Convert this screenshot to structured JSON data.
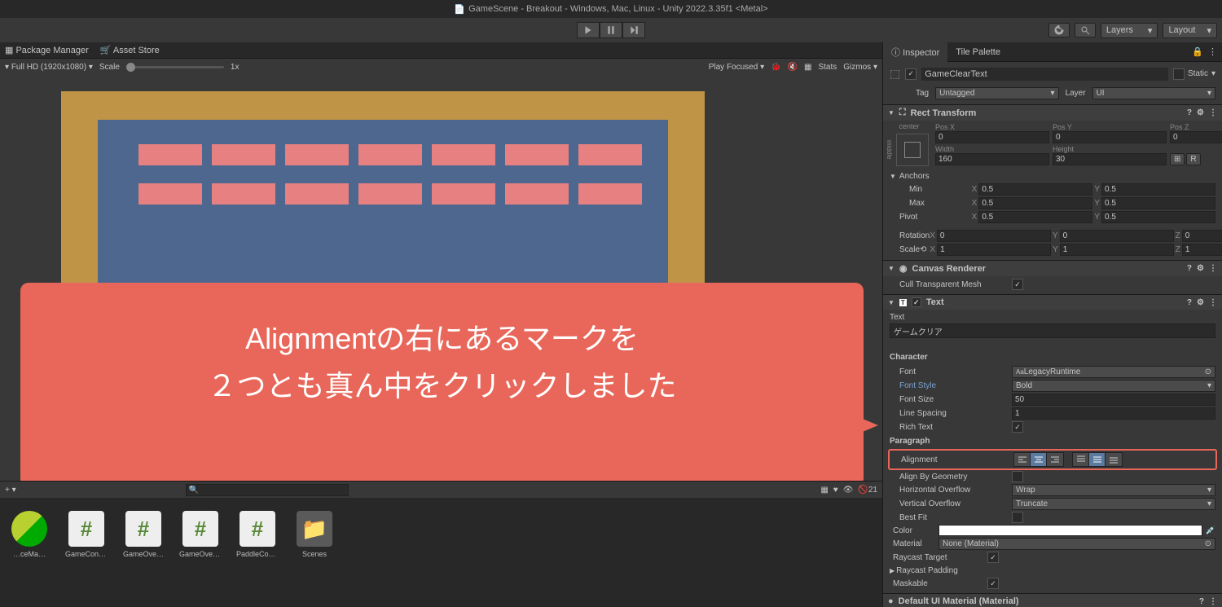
{
  "titlebar": "GameScene - Breakout - Windows, Mac, Linux - Unity 2022.3.35f1 <Metal>",
  "toolbar": {
    "layers": "Layers",
    "layout": "Layout"
  },
  "scene_tabs": {
    "package_manager": "Package Manager",
    "asset_store": "Asset Store"
  },
  "scene_controls": {
    "resolution": "Full HD (1920x1080)",
    "scale": "Scale",
    "scale_val": "1x",
    "play_focused": "Play Focused",
    "stats": "Stats",
    "gizmos": "Gizmos"
  },
  "project_bar": {
    "count": "21"
  },
  "assets": [
    {
      "label": "…ceMa…",
      "type": "ball"
    },
    {
      "label": "GameCont…",
      "type": "cs"
    },
    {
      "label": "GameOve…",
      "type": "cs"
    },
    {
      "label": "GameOver…",
      "type": "cs"
    },
    {
      "label": "PaddleCon…",
      "type": "cs"
    },
    {
      "label": "Scenes",
      "type": "folder"
    }
  ],
  "inspector": {
    "tabs": {
      "inspector": "Inspector",
      "tile_palette": "Tile Palette"
    },
    "obj_name": "GameClearText",
    "static": "Static",
    "tag_label": "Tag",
    "tag_value": "Untagged",
    "layer_label": "Layer",
    "layer_value": "UI",
    "rect_transform": {
      "title": "Rect Transform",
      "anchor_top": "center",
      "anchor_side": "middle",
      "posx_l": "Pos X",
      "posx": "0",
      "posy_l": "Pos Y",
      "posy": "0",
      "posz_l": "Pos Z",
      "posz": "0",
      "width_l": "Width",
      "width": "160",
      "height_l": "Height",
      "height": "30",
      "anchors": "Anchors",
      "min": "Min",
      "minx": "0.5",
      "miny": "0.5",
      "max": "Max",
      "maxx": "0.5",
      "maxy": "0.5",
      "pivot": "Pivot",
      "pivx": "0.5",
      "pivy": "0.5",
      "rotation": "Rotation",
      "rx": "0",
      "ry": "0",
      "rz": "0",
      "scale": "Scale",
      "sx": "1",
      "sy": "1",
      "sz": "1",
      "r_btn": "R"
    },
    "canvas_renderer": {
      "title": "Canvas Renderer",
      "cull": "Cull Transparent Mesh"
    },
    "text": {
      "title": "Text",
      "text_label": "Text",
      "text_value": "ゲームクリア",
      "character": "Character",
      "font": "Font",
      "font_value": "LegacyRuntime",
      "font_style": "Font Style",
      "font_style_value": "Bold",
      "font_size": "Font Size",
      "font_size_value": "50",
      "line_spacing": "Line Spacing",
      "line_spacing_value": "1",
      "rich_text": "Rich Text",
      "paragraph": "Paragraph",
      "alignment": "Alignment",
      "align_geom": "Align By Geometry",
      "h_overflow": "Horizontal Overflow",
      "h_overflow_value": "Wrap",
      "v_overflow": "Vertical Overflow",
      "v_overflow_value": "Truncate",
      "best_fit": "Best Fit",
      "color": "Color",
      "material": "Material",
      "material_value": "None (Material)",
      "raycast": "Raycast Target",
      "raycast_padding": "Raycast Padding",
      "maskable": "Maskable"
    },
    "default_mat": "Default UI Material (Material)"
  },
  "annotation": {
    "line1": "Alignmentの右にあるマークを",
    "line2": "２つとも真ん中をクリックしました"
  }
}
